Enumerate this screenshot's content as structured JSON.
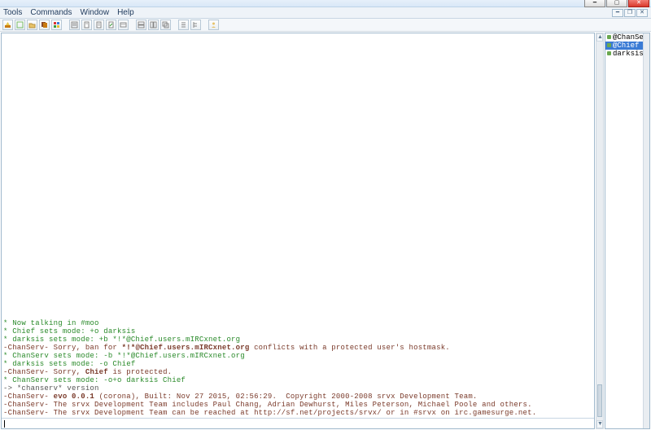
{
  "menu": {
    "items": [
      "Tools",
      "Commands",
      "Window",
      "Help"
    ]
  },
  "toolbar": {
    "buttons": [
      "connect",
      "new-server",
      "open",
      "copy",
      "colors",
      "settings",
      "favorites",
      "script",
      "sendfile",
      "xfer",
      "tile-h",
      "tile-v",
      "cascade",
      "list",
      "treeview",
      "addressbook"
    ]
  },
  "nicklist": [
    {
      "label": "@ChanServ",
      "selected": false
    },
    {
      "label": "@Chief",
      "selected": true
    },
    {
      "label": "darksis",
      "selected": false
    }
  ],
  "chat": [
    {
      "cls": "c-green",
      "prefix": "*",
      "text": "Now talking in #moo"
    },
    {
      "cls": "c-green",
      "prefix": "*",
      "text": "Chief sets mode: +o darksis"
    },
    {
      "cls": "c-green",
      "prefix": "*",
      "text": "darksis sets mode: +b *!*@Chief.users.mIRCxnet.org"
    },
    {
      "cls": "c-maroon",
      "prefix": "-ChanServ-",
      "frags": [
        {
          "t": "Sorry, ban for "
        },
        {
          "t": "*!*@Chief.users.mIRCxnet.org",
          "b": true
        },
        {
          "t": " conflicts with a protected user's hostmask."
        }
      ]
    },
    {
      "cls": "c-green",
      "prefix": "*",
      "text": "ChanServ sets mode: -b *!*@Chief.users.mIRCxnet.org"
    },
    {
      "cls": "c-green",
      "prefix": "*",
      "text": "darksis sets mode: -o Chief"
    },
    {
      "cls": "c-maroon",
      "prefix": "-ChanServ-",
      "frags": [
        {
          "t": "Sorry, "
        },
        {
          "t": "Chief",
          "b": true
        },
        {
          "t": " is protected."
        }
      ]
    },
    {
      "cls": "c-green",
      "prefix": "*",
      "text": "ChanServ sets mode: -o+o darksis Chief"
    },
    {
      "cls": "c-gray",
      "prefix": "->",
      "text": "*chanserv* version"
    },
    {
      "cls": "c-maroon",
      "prefix": "-ChanServ-",
      "frags": [
        {
          "t": "evo 0.0.1",
          "b": true
        },
        {
          "t": " (corona), Built: Nov 27 2015, 02:56:29.  Copyright 2000-2008 srvx Development Team."
        }
      ]
    },
    {
      "cls": "c-maroon",
      "prefix": "-ChanServ-",
      "text": "The srvx Development Team includes Paul Chang, Adrian Dewhurst, Miles Peterson, Michael Poole and others."
    },
    {
      "cls": "c-maroon",
      "prefix": "-ChanServ-",
      "text": "The srvx Development Team can be reached at http://sf.net/projects/srvx/ or in #srvx on irc.gamesurge.net."
    }
  ]
}
